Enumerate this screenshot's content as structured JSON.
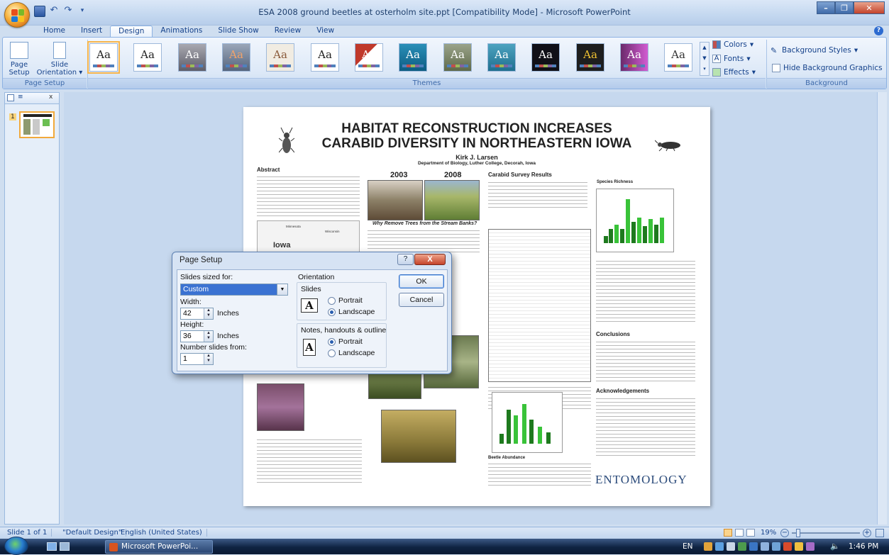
{
  "window": {
    "title": "ESA 2008 ground beetles at osterholm site.ppt [Compatibility Mode] - Microsoft PowerPoint"
  },
  "tabs": [
    "Home",
    "Insert",
    "Design",
    "Animations",
    "Slide Show",
    "Review",
    "View"
  ],
  "active_tab": "Design",
  "ribbon": {
    "page_setup": {
      "page_setup_label": "Page Setup",
      "orientation_label": "Slide Orientation",
      "group_label": "Page Setup"
    },
    "themes": {
      "group_label": "Themes",
      "sample": "Aa",
      "colors": "Colors",
      "fonts": "Fonts",
      "effects": "Effects"
    },
    "background": {
      "styles": "Background Styles",
      "hide": "Hide Background Graphics",
      "group_label": "Background"
    }
  },
  "slide": {
    "title_line1": "HABITAT RECONSTRUCTION INCREASES",
    "title_line2": "CARABID DIVERSITY IN NORTHEASTERN IOWA",
    "author": "Kirk J. Larsen",
    "affiliation": "Department of Biology, Luther College, Decorah, Iowa",
    "abstract_head": "Abstract",
    "year1": "2003",
    "year2": "2008",
    "why_head": "Why Remove Trees from the Stream Banks?",
    "survey_head": "Carabid Survey Results",
    "richness_head": "Species Richness",
    "conclusions_head": "Conclusions",
    "ack_head": "Acknowledgements",
    "abundance_head": "Beetle Abundance",
    "map_state": "Iowa",
    "map_minnesota": "Minnesota",
    "map_wisconsin": "Wisconsin",
    "logo": "ENTOMOLOGY"
  },
  "dialog": {
    "title": "Page Setup",
    "help": "?",
    "close": "X",
    "slides_sized_for": "Slides sized for:",
    "size_value": "Custom",
    "width_label": "Width:",
    "width_value": "42",
    "height_label": "Height:",
    "height_value": "36",
    "unit": "Inches",
    "number_from_label": "Number slides from:",
    "number_from_value": "1",
    "orientation_label": "Orientation",
    "slides_label": "Slides",
    "portrait": "Portrait",
    "landscape": "Landscape",
    "notes_label": "Notes, handouts & outline",
    "slides_orientation": "landscape",
    "notes_orientation": "portrait",
    "ok": "OK",
    "cancel": "Cancel"
  },
  "status": {
    "slide_info": "Slide 1 of 1",
    "theme": "\"Default Design\"",
    "language": "English (United States)",
    "zoom": "19%"
  },
  "taskbar": {
    "app": "Microsoft PowerPoi...",
    "lang": "EN",
    "time": "1:46 PM"
  },
  "colors": {
    "accent": "#15428b",
    "selected_theme": "#f7b54b",
    "dialog_selection": "#3a72d2"
  }
}
